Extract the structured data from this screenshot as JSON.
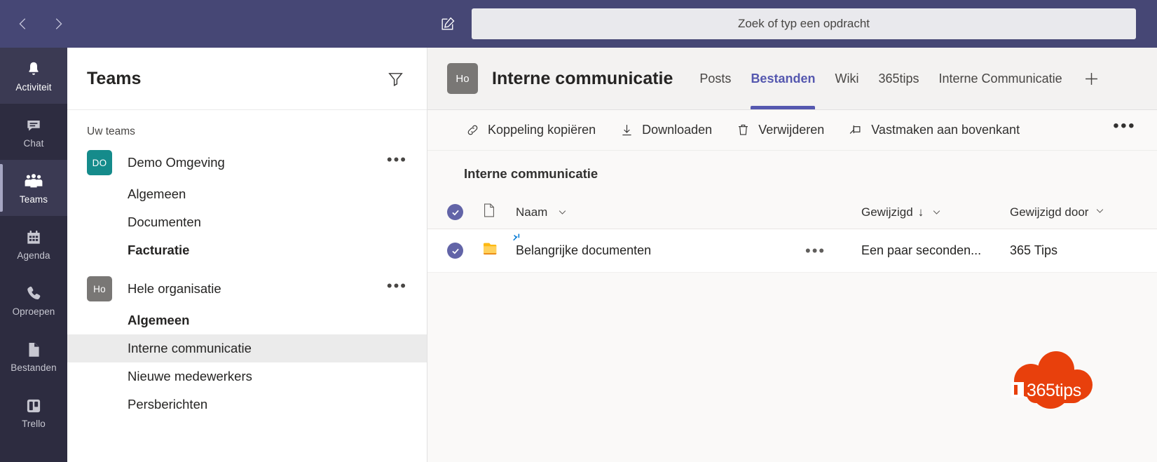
{
  "topbar": {
    "back_icon": "chevron-left-icon",
    "forward_icon": "chevron-right-icon",
    "compose_icon": "compose-pencil-icon",
    "search_placeholder": "Zoek of typ een opdracht",
    "search_value": "",
    "background_color": "#464775"
  },
  "rail": {
    "background_color": "#2d2c40",
    "items": [
      {
        "label": "Activiteit",
        "icon": "bell-icon",
        "active": false,
        "highlighted": true
      },
      {
        "label": "Chat",
        "icon": "chat-bubble-icon",
        "active": false,
        "highlighted": false
      },
      {
        "label": "Teams",
        "icon": "people-icon",
        "active": true,
        "highlighted": false
      },
      {
        "label": "Agenda",
        "icon": "calendar-icon",
        "active": false,
        "highlighted": false
      },
      {
        "label": "Oproepen",
        "icon": "phone-icon",
        "active": false,
        "highlighted": false
      },
      {
        "label": "Bestanden",
        "icon": "file-icon",
        "active": false,
        "highlighted": false
      },
      {
        "label": "Trello",
        "icon": "trello-icon",
        "active": false,
        "highlighted": false
      }
    ]
  },
  "teams_panel": {
    "title": "Teams",
    "filter_icon": "filter-funnel-icon",
    "section_label": "Uw teams",
    "more_glyph": "•••",
    "teams": [
      {
        "initials": "DO",
        "name": "Demo Omgeving",
        "avatar_color": "#158b8b",
        "channels": [
          {
            "name": "Algemeen",
            "unread": false,
            "selected": false
          },
          {
            "name": "Documenten",
            "unread": false,
            "selected": false
          },
          {
            "name": "Facturatie",
            "unread": true,
            "selected": false
          }
        ]
      },
      {
        "initials": "Ho",
        "name": "Hele organisatie",
        "avatar_color": "#797775",
        "channels": [
          {
            "name": "Algemeen",
            "unread": true,
            "selected": false
          },
          {
            "name": "Interne communicatie",
            "unread": false,
            "selected": true
          },
          {
            "name": "Nieuwe medewerkers",
            "unread": false,
            "selected": false
          },
          {
            "name": "Persberichten",
            "unread": false,
            "selected": false
          }
        ]
      }
    ]
  },
  "channel_header": {
    "avatar_initials": "Ho",
    "avatar_color": "#797775",
    "title": "Interne communicatie",
    "active_tab_color": "#5558af",
    "add_tab_icon": "plus-icon",
    "tabs": [
      {
        "label": "Posts",
        "active": false
      },
      {
        "label": "Bestanden",
        "active": true
      },
      {
        "label": "Wiki",
        "active": false
      },
      {
        "label": "365tips",
        "active": false
      },
      {
        "label": "Interne Communicatie",
        "active": false
      }
    ]
  },
  "command_bar": {
    "overflow_glyph": "•••",
    "commands": [
      {
        "label": "Koppeling kopiëren",
        "icon": "link-icon"
      },
      {
        "label": "Downloaden",
        "icon": "download-icon"
      },
      {
        "label": "Verwijderen",
        "icon": "trash-icon"
      },
      {
        "label": "Vastmaken aan bovenkant",
        "icon": "pin-icon"
      }
    ]
  },
  "file_list": {
    "breadcrumb": "Interne communicatie",
    "select_all_icon": "checked-circle-icon",
    "type_icon": "file-type-icon",
    "columns": {
      "name": "Naam",
      "modified": "Gewijzigd",
      "modified_by": "Gewijzigd door"
    },
    "sort": {
      "column": "Gewijzigd",
      "direction_glyph": "↓"
    },
    "row_more_glyph": "•••",
    "rows": [
      {
        "selected": true,
        "icon": "folder-icon",
        "is_new": true,
        "name": "Belangrijke documenten",
        "modified": "Een paar seconden...",
        "modified_by": "365 Tips"
      }
    ]
  },
  "watermark": {
    "text": "365tips",
    "color": "#e8400c",
    "shape": "cloud-icon"
  }
}
